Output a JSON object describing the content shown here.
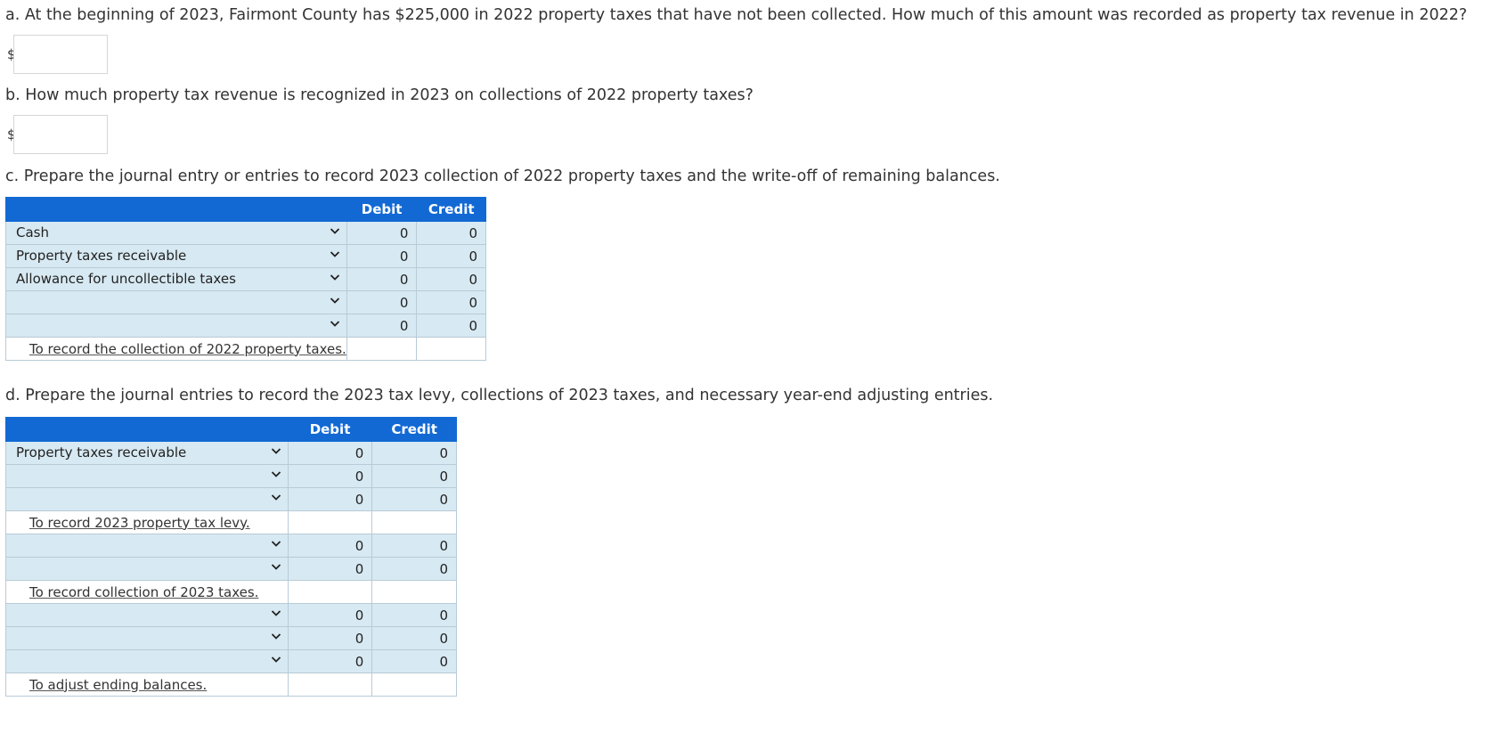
{
  "part_a": {
    "question": "a. At the beginning of 2023, Fairmont County has $225,000 in 2022 property taxes that have not been collected. How much of this amount was recorded as property tax revenue in 2022?",
    "currency": "$",
    "value": ""
  },
  "part_b": {
    "question": "b. How much property tax revenue is recognized in 2023 on collections of 2022 property taxes?",
    "currency": "$",
    "value": ""
  },
  "part_c": {
    "question": "c. Prepare the journal entry or entries to record 2023 collection of 2022 property taxes and the write-off of remaining balances.",
    "debit_header": "Debit",
    "credit_header": "Credit",
    "rows": [
      {
        "account": "Cash",
        "debit": "0",
        "credit": "0"
      },
      {
        "account": "Property taxes receivable",
        "debit": "0",
        "credit": "0"
      },
      {
        "account": "Allowance for uncollectible taxes",
        "debit": "0",
        "credit": "0"
      },
      {
        "account": "",
        "debit": "0",
        "credit": "0"
      },
      {
        "account": "",
        "debit": "0",
        "credit": "0"
      }
    ],
    "note": "To record the collection of 2022 property taxes."
  },
  "part_d": {
    "question": "d. Prepare the journal entries to record the 2023 tax levy, collections of 2023 taxes, and necessary year-end adjusting entries.",
    "debit_header": "Debit",
    "credit_header": "Credit",
    "entry1": {
      "rows": [
        {
          "account": "Property taxes receivable",
          "debit": "0",
          "credit": "0"
        },
        {
          "account": "",
          "debit": "0",
          "credit": "0"
        },
        {
          "account": "",
          "debit": "0",
          "credit": "0"
        }
      ],
      "note": "To record 2023 property tax levy."
    },
    "entry2": {
      "rows": [
        {
          "account": "",
          "debit": "0",
          "credit": "0"
        },
        {
          "account": "",
          "debit": "0",
          "credit": "0"
        }
      ],
      "note": "To record collection of 2023 taxes."
    },
    "entry3": {
      "rows": [
        {
          "account": "",
          "debit": "0",
          "credit": "0"
        },
        {
          "account": "",
          "debit": "0",
          "credit": "0"
        },
        {
          "account": "",
          "debit": "0",
          "credit": "0"
        }
      ],
      "note": "To adjust ending balances."
    }
  },
  "icons": {
    "dropdown": "chevron-down-icon"
  },
  "colors": {
    "header_bg": "#1269d4",
    "row_bg": "#d7e9f2",
    "border": "#b8cbd6"
  }
}
